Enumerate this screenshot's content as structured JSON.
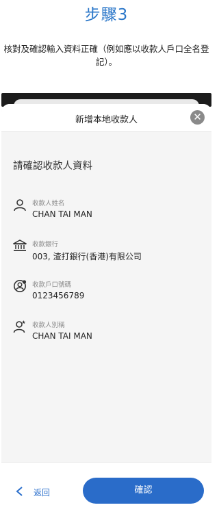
{
  "step_title": "步驟3",
  "instruction": "核對及確認輸入資料正確（例如應以收款人戶口全名登記）。",
  "sheet": {
    "title": "新增本地收款人",
    "close_icon": "close-icon",
    "section_heading": "請確認收款人資料"
  },
  "fields": [
    {
      "icon": "person-icon",
      "label": "收款人姓名",
      "value": "CHAN TAI MAN"
    },
    {
      "icon": "bank-icon",
      "label": "收款銀行",
      "value": "003, 渣打銀行(香港)有限公司"
    },
    {
      "icon": "account-number-icon",
      "label": "收款戶口號碼",
      "value": "0123456789"
    },
    {
      "icon": "nickname-person-icon",
      "label": "收款人別稱",
      "value": "CHAN TAI MAN"
    }
  ],
  "footer": {
    "back_label": "返回",
    "confirm_label": "確認"
  },
  "colors": {
    "accent": "#2a6cc9",
    "title_blue": "#2b77c9",
    "sheet_bg": "#f5f5f5"
  }
}
